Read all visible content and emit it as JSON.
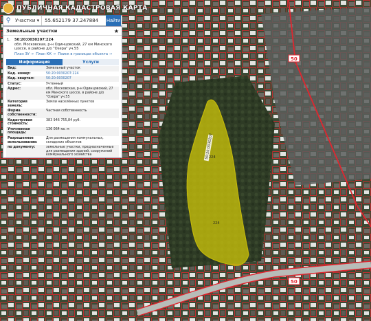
{
  "header": {
    "title": "ПУБЛИЧНАЯ КАДАСТРОВАЯ КАРТА"
  },
  "search": {
    "type_label": "Участки",
    "value": "55.652179 37.247884",
    "button_label": "Найти"
  },
  "panel": {
    "title": "Земельные участки",
    "result": {
      "index": "1.",
      "cadastral_number": "50:20:0030207:224",
      "address": "обл. Московская, р-н Одинцовский, 27 км Минского шоссе, в районе д/о \"Озера\" уч.55",
      "links": [
        "План ЗУ",
        "План КК",
        "Поиск в границах объекта"
      ]
    },
    "tabs": [
      {
        "label": "Информация",
        "active": true
      },
      {
        "label": "Услуги",
        "active": false
      }
    ],
    "rows": [
      {
        "key": "Вид:",
        "value": "Земельный участок",
        "link": false
      },
      {
        "key": "Кад. номер:",
        "value": "50:20:0030207:224",
        "link": true
      },
      {
        "key": "Кад. квартал:",
        "value": "50:20:0030207",
        "link": true
      },
      {
        "key": "Статус:",
        "value": "Учтенный",
        "link": false
      },
      {
        "key": "Адрес:",
        "value": "обл. Московская, р-н Одинцовский, 27 км Минского шоссе, в районе д/о \"Озера\" уч.55",
        "link": false
      },
      {
        "key": "Категория земель:",
        "value": "Земли населённых пунктов",
        "link": false
      },
      {
        "key": "Форма собственности:",
        "value": "Частная собственность",
        "link": false
      },
      {
        "key": "Кадастровая стоимость:",
        "value": "383 946 755,84 руб.",
        "link": false
      },
      {
        "key": "Уточненная площадь:",
        "value": "136 064 кв. м",
        "link": false
      },
      {
        "key": "Разрешенное использование:",
        "value": "Для размещения коммунальных, складских объектов",
        "link": false
      },
      {
        "key": "по документу:",
        "value": "земельные участки, предназначенные для размещения зданий, сооружений коммунального хозяйства",
        "link": false
      }
    ]
  },
  "map": {
    "road_label": "50",
    "parcel_labels": [
      "50:20:0030207",
      "224",
      "224"
    ],
    "colors": {
      "parcel_fill": "#c9c20a",
      "boundary": "#e0262f",
      "terrain": "#3b4a34"
    }
  }
}
